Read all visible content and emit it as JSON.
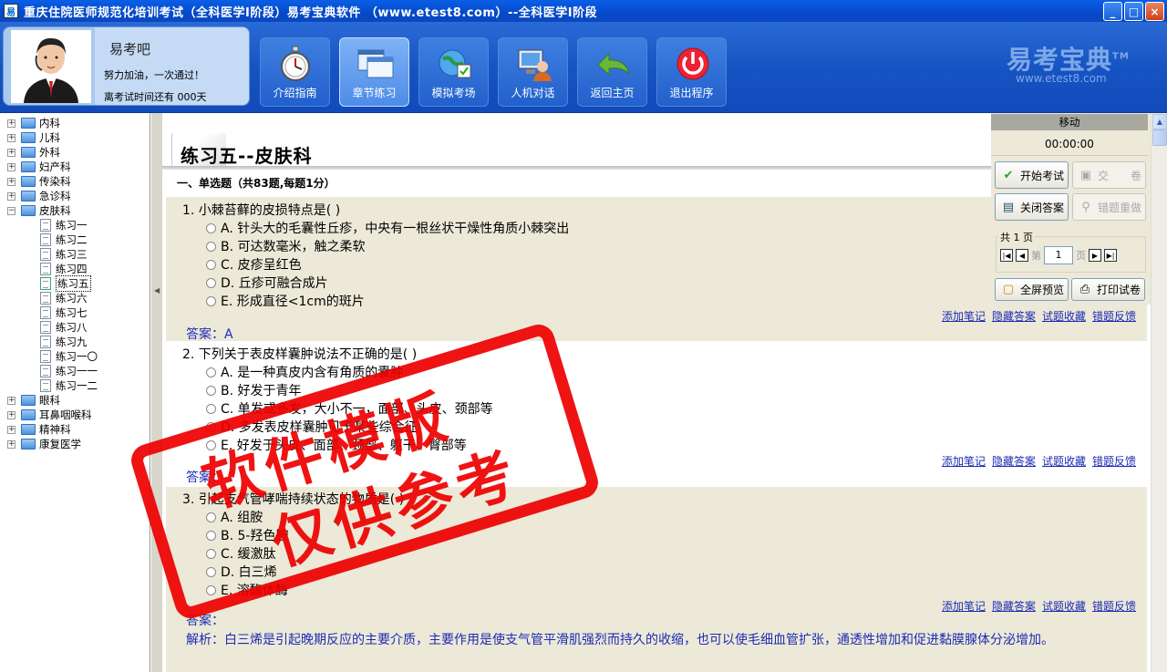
{
  "window": {
    "title": "重庆住院医师规范化培训考试（全科医学Ⅰ阶段）易考宝典软件 （www.etest8.com）--全科医学Ⅰ阶段",
    "controls": [
      "minimize",
      "maximize",
      "close"
    ]
  },
  "user": {
    "name": "易考吧",
    "motto": "努力加油，一次通过！",
    "countdown": "离考试时间还有 000天"
  },
  "nav": [
    {
      "label": "介绍指南",
      "icon": "stopwatch-icon"
    },
    {
      "label": "章节练习",
      "icon": "windows-icon",
      "active": true
    },
    {
      "label": "模拟考场",
      "icon": "globe-exam-icon"
    },
    {
      "label": "人机对话",
      "icon": "computer-user-icon"
    },
    {
      "label": "返回主页",
      "icon": "return-arrow-icon"
    },
    {
      "label": "退出程序",
      "icon": "power-icon"
    }
  ],
  "brand": {
    "name": "易考宝典",
    "tm": "TM",
    "url": "www.etest8.com"
  },
  "tree": {
    "categories_before": [
      "内科",
      "儿科",
      "外科",
      "妇产科",
      "传染科",
      "急诊科"
    ],
    "expanded": "皮肤科",
    "exercises": [
      "练习一",
      "练习二",
      "练习三",
      "练习四",
      "练习五",
      "练习六",
      "练习七",
      "练习八",
      "练习九",
      "练习一〇",
      "练习一一",
      "练习一二"
    ],
    "selected_exercise": "练习五",
    "categories_after": [
      "眼科",
      "耳鼻咽喉科",
      "精神科",
      "康复医学"
    ]
  },
  "content": {
    "title": "练习五--皮肤科",
    "section": "一、单选题（共83题,每题1分）",
    "questions": [
      {
        "text": "1. 小棘苔藓的皮损特点是( )",
        "options": [
          "A. 针头大的毛囊性丘疹，中央有一根丝状干燥性角质小棘突出",
          "B. 可达数毫米，触之柔软",
          "C. 皮疹呈红色",
          "D. 丘疹可融合成片",
          "E. 形成直径<1cm的斑片"
        ],
        "answer": "答案：A"
      },
      {
        "text": "2. 下列关于表皮样囊肿说法不正确的是( )",
        "options": [
          "A. 是一种真皮内含有角质的囊肿",
          "B. 好发于青年",
          "C. 单发或多发，大小不一，面部、头皮、颈部等",
          "D. 多发表皮样囊肿见于某些综合征",
          "E. 好发于头皮、面部、颈部、躯干、臀部等"
        ],
        "answer": "答案："
      },
      {
        "text": "3. 引起支气管哮喘持续状态的物质是( )",
        "options": [
          "A. 组胺",
          "B. 5-羟色胺",
          "C. 缓激肽",
          "D. 白三烯",
          "E. 溶酶体酶"
        ],
        "answer": "答案：",
        "analysis": "解析：白三烯是引起晚期反应的主要介质，主要作用是使支气管平滑肌强烈而持久的收缩，也可以使毛细血管扩张，通透性增加和促进黏膜腺体分泌增加。"
      }
    ],
    "links": [
      "添加笔记",
      "隐藏答案",
      "试题收藏",
      "错题反馈"
    ]
  },
  "panel": {
    "header": "移动",
    "timer": "00:00:00",
    "buttons": {
      "start": "开始考试",
      "submit": "交　　卷",
      "close_answer": "关闭答案",
      "redo": "错题重做",
      "preview": "全屏预览",
      "print": "打印试卷"
    },
    "page_count": "共 1 页",
    "page_prefix": "第",
    "page_value": "1",
    "page_suffix": "页"
  },
  "stamp": {
    "line1": "软件模版",
    "line2": "仅供参考"
  }
}
